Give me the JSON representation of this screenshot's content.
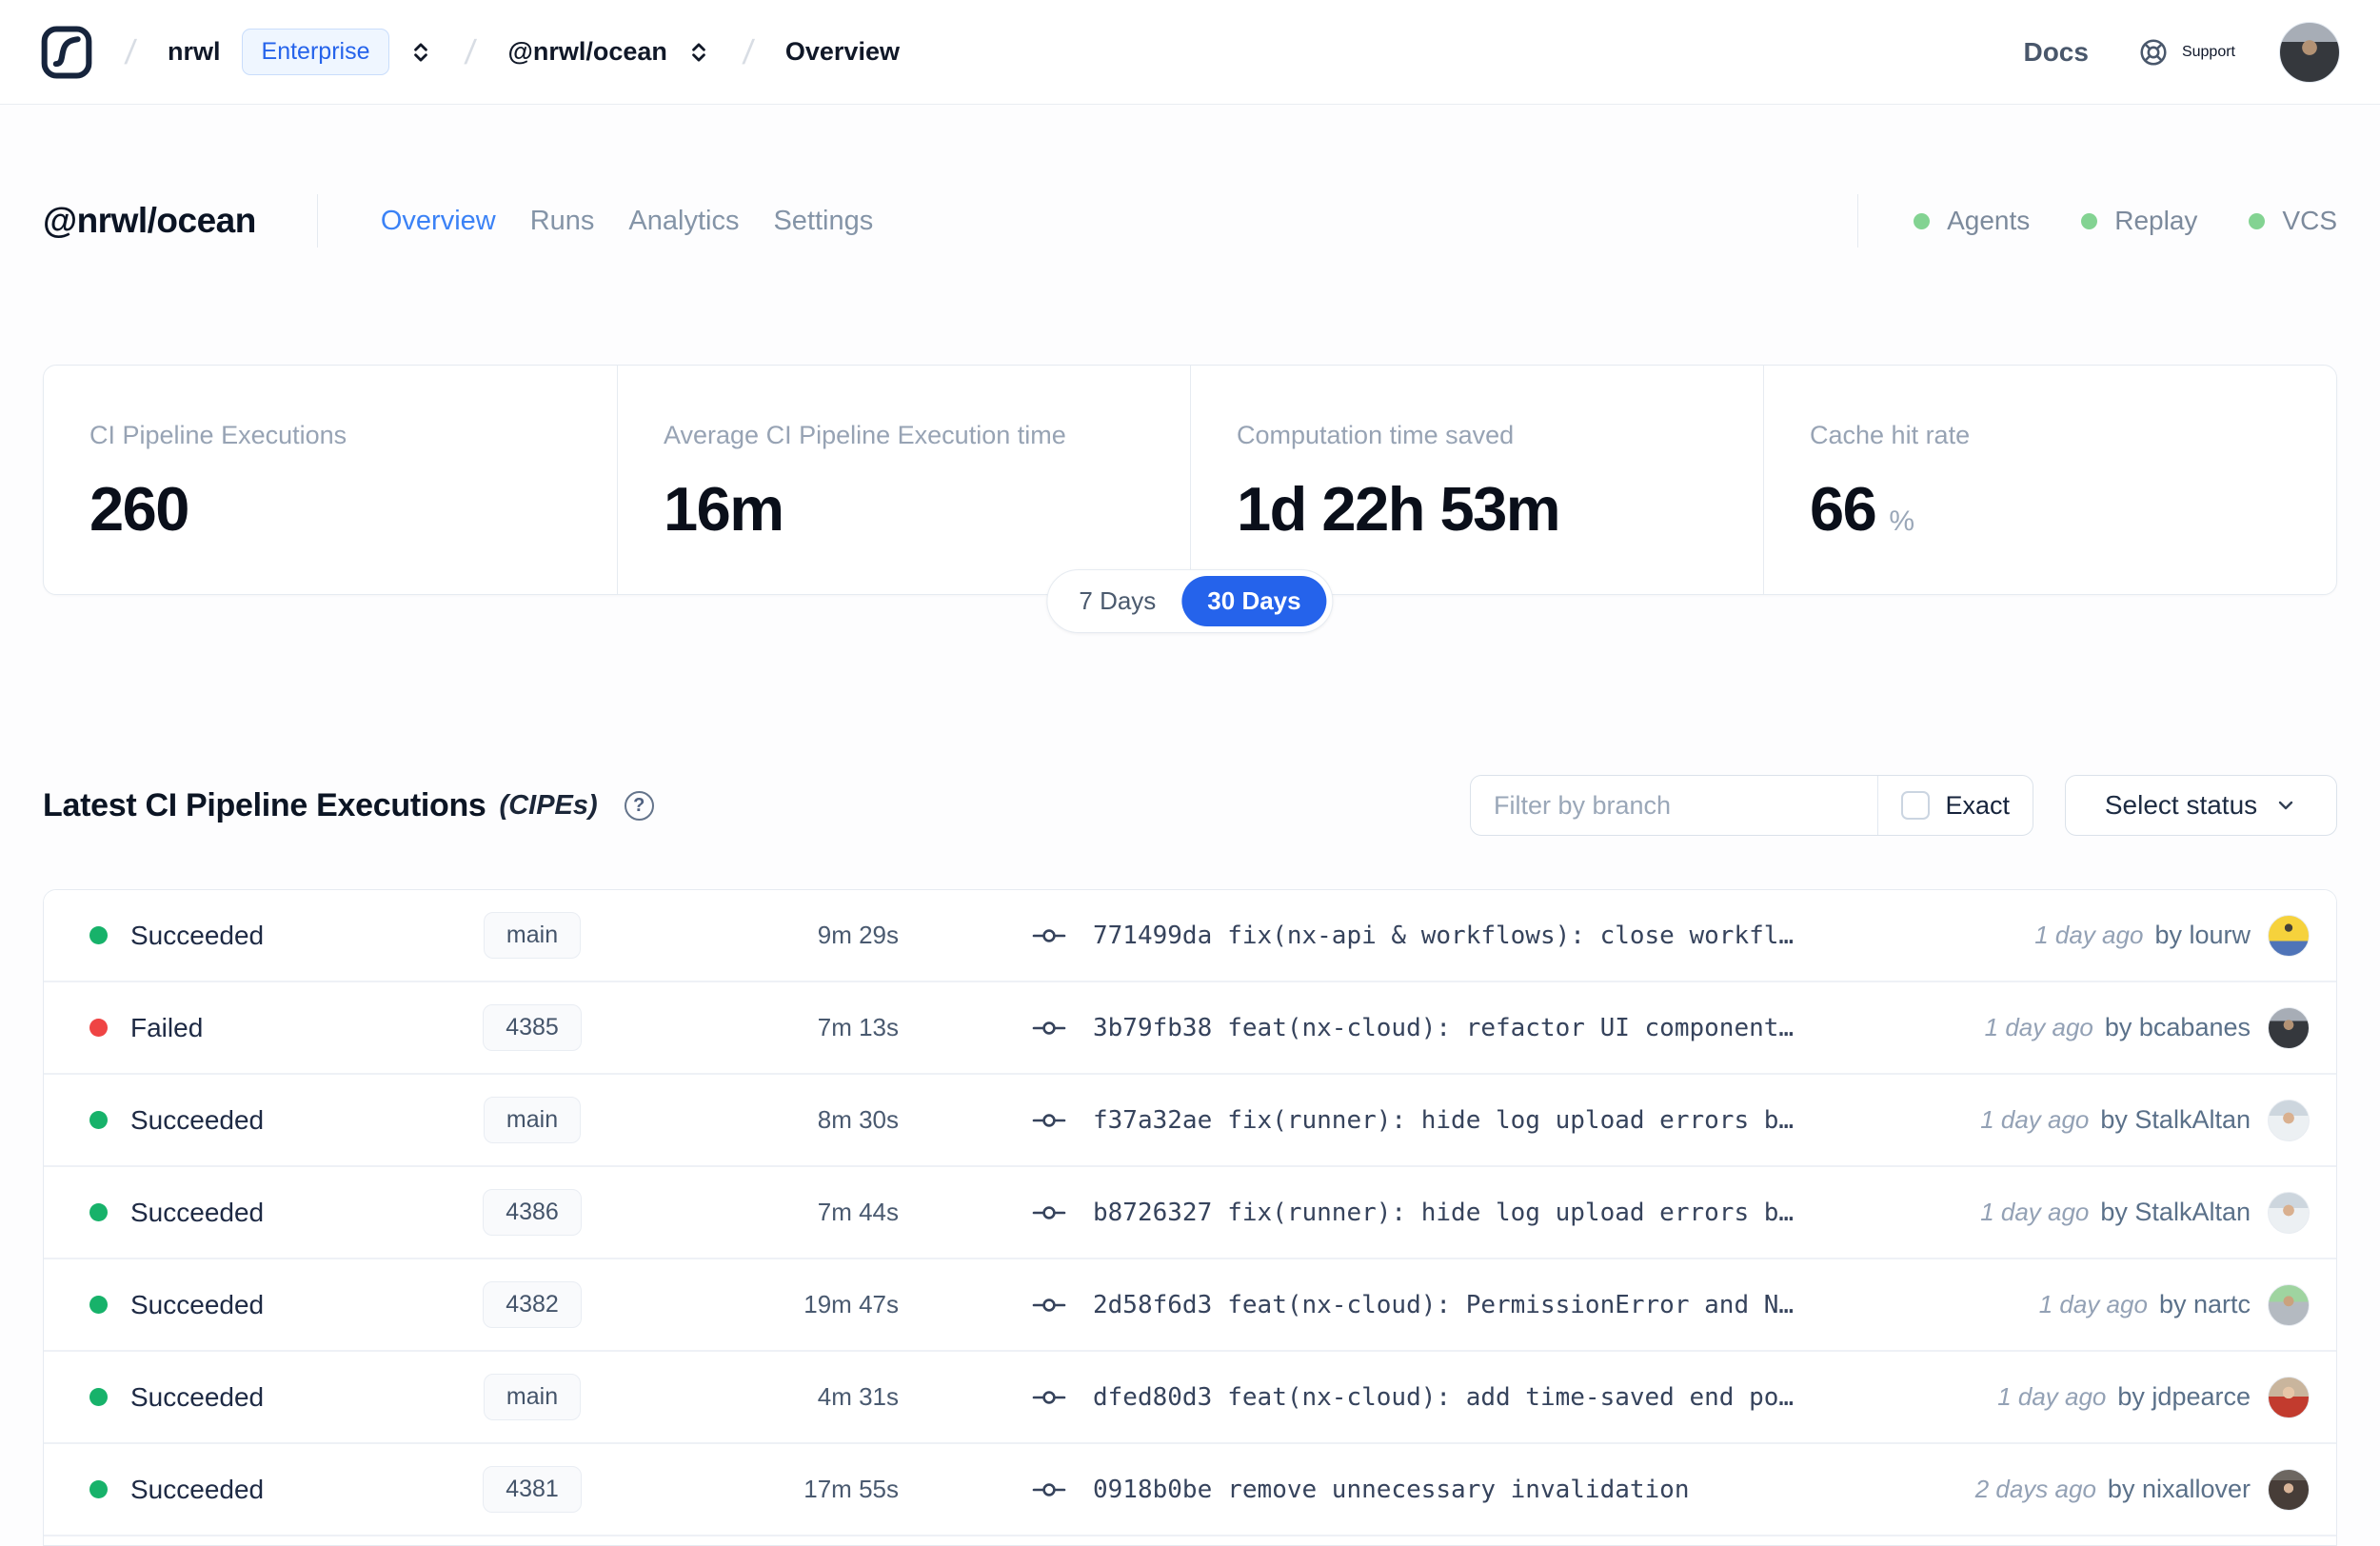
{
  "colors": {
    "success": "#17b26a",
    "failure": "#ef4444",
    "accent": "#2563eb",
    "active_tab": "#3b82f6",
    "service_dot": "#83d392"
  },
  "nav": {
    "breadcrumb": {
      "org": "nrwl",
      "org_badge": "Enterprise",
      "workspace": "@nrwl/ocean",
      "page": "Overview"
    },
    "links": {
      "docs": "Docs",
      "support": "Support"
    }
  },
  "workspace": {
    "title": "@nrwl/ocean",
    "tabs": [
      "Overview",
      "Runs",
      "Analytics",
      "Settings"
    ],
    "active_tab": "Overview",
    "services": [
      "Agents",
      "Replay",
      "VCS"
    ]
  },
  "stats": {
    "cards": [
      {
        "label": "CI Pipeline Executions",
        "value": "260",
        "unit": ""
      },
      {
        "label": "Average CI Pipeline Execution time",
        "value": "16m",
        "unit": ""
      },
      {
        "label": "Computation time saved",
        "value": "1d 22h 53m",
        "unit": ""
      },
      {
        "label": "Cache hit rate",
        "value": "66",
        "unit": "%"
      }
    ],
    "range": {
      "options": [
        "7 Days",
        "30 Days"
      ],
      "selected": "30 Days"
    }
  },
  "cipes": {
    "title": "Latest CI Pipeline Executions",
    "suffix": "(CIPEs)",
    "filter": {
      "placeholder": "Filter by branch",
      "exact_label": "Exact",
      "exact_checked": false,
      "status_button": "Select status"
    },
    "rows": [
      {
        "status": "Succeeded",
        "branch": "main",
        "duration": "9m 29s",
        "commit_hash": "771499da",
        "commit_message": "fix(nx-api & workflows): close workfl…",
        "time_ago": "1 day ago",
        "author": "by lourw",
        "avatar": "lourw"
      },
      {
        "status": "Failed",
        "branch": "4385",
        "duration": "7m 13s",
        "commit_hash": "3b79fb38",
        "commit_message": "feat(nx-cloud): refactor UI component…",
        "time_ago": "1 day ago",
        "author": "by bcabanes",
        "avatar": "bcabanes"
      },
      {
        "status": "Succeeded",
        "branch": "main",
        "duration": "8m 30s",
        "commit_hash": "f37a32ae",
        "commit_message": "fix(runner): hide log upload errors b…",
        "time_ago": "1 day ago",
        "author": "by StalkAltan",
        "avatar": "stalkaltan"
      },
      {
        "status": "Succeeded",
        "branch": "4386",
        "duration": "7m 44s",
        "commit_hash": "b8726327",
        "commit_message": "fix(runner): hide log upload errors b…",
        "time_ago": "1 day ago",
        "author": "by StalkAltan",
        "avatar": "stalkaltan"
      },
      {
        "status": "Succeeded",
        "branch": "4382",
        "duration": "19m 47s",
        "commit_hash": "2d58f6d3",
        "commit_message": "feat(nx-cloud): PermissionError and N…",
        "time_ago": "1 day ago",
        "author": "by nartc",
        "avatar": "nartc"
      },
      {
        "status": "Succeeded",
        "branch": "main",
        "duration": "4m 31s",
        "commit_hash": "dfed80d3",
        "commit_message": "feat(nx-cloud): add time-saved end po…",
        "time_ago": "1 day ago",
        "author": "by jdpearce",
        "avatar": "jdpearce"
      },
      {
        "status": "Succeeded",
        "branch": "4381",
        "duration": "17m 55s",
        "commit_hash": "0918b0be",
        "commit_message": "remove unnecessary invalidation",
        "time_ago": "2 days ago",
        "author": "by nixallover",
        "avatar": "nixallover"
      }
    ]
  }
}
